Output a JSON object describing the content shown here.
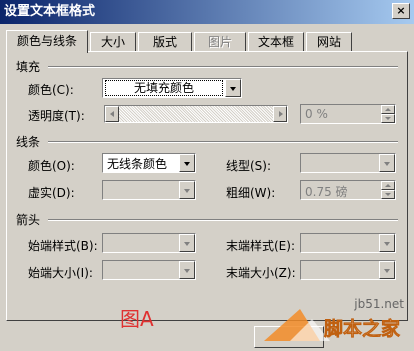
{
  "window": {
    "title": "设置文本框格式",
    "close_glyph": "×"
  },
  "tabs": [
    {
      "label": "颜色与线条",
      "active": true
    },
    {
      "label": "大小"
    },
    {
      "label": "版式"
    },
    {
      "label": "图片",
      "disabled": true
    },
    {
      "label": "文本框"
    },
    {
      "label": "网站"
    }
  ],
  "fill": {
    "group_label": "填充",
    "color_label": "颜色(C):",
    "color_value": "无填充颜色",
    "transparency_label": "透明度(T):",
    "transparency_value": "0 %"
  },
  "line": {
    "group_label": "线条",
    "color_label": "颜色(O):",
    "color_value": "无线条颜色",
    "style_label": "线型(S):",
    "dash_label": "虚实(D):",
    "weight_label": "粗细(W):",
    "weight_value": "0.75 磅"
  },
  "arrows": {
    "group_label": "箭头",
    "begin_style_label": "始端样式(B):",
    "end_style_label": "末端样式(E):",
    "begin_size_label": "始端大小(I):",
    "end_size_label": "末端大小(Z):"
  },
  "annotation": {
    "figure_label": "图A"
  },
  "watermark": {
    "site_text": "jb51.net",
    "brand": "脚本之家"
  },
  "colors": {
    "title_gradient_start": "#0a246a",
    "title_gradient_end": "#a6caf0",
    "annotation": "#e03030",
    "watermark_orange": "#f28c28"
  }
}
